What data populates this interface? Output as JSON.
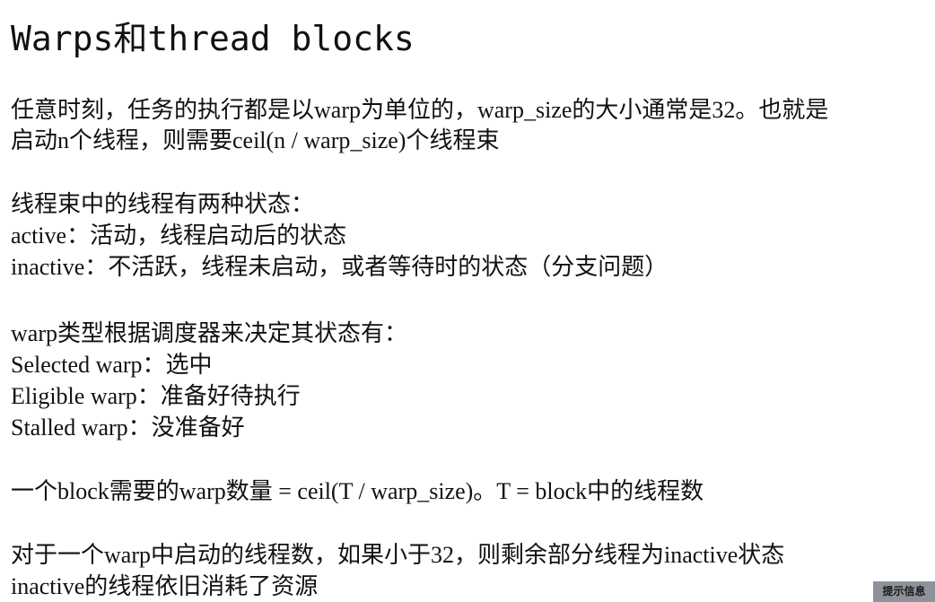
{
  "title": "Warps和thread blocks",
  "lines": [
    "任意时刻，任务的执行都是以warp为单位的，warp_size的大小通常是32。也就是",
    "启动n个线程，则需要ceil(n / warp_size)个线程束",
    "线程束中的线程有两种状态：",
    "active：活动，线程启动后的状态",
    "inactive：不活跃，线程未启动，或者等待时的状态（分支问题）",
    "warp类型根据调度器来决定其状态有：",
    "Selected warp：选中",
    "Eligible warp：准备好待执行",
    "Stalled warp：没准备好",
    "一个block需要的warp数量 = ceil(T / warp_size)。T = block中的线程数",
    "对于一个warp中启动的线程数，如果小于32，则剩余部分线程为inactive状态",
    "inactive的线程依旧消耗了资源"
  ],
  "badge": "提示信息"
}
